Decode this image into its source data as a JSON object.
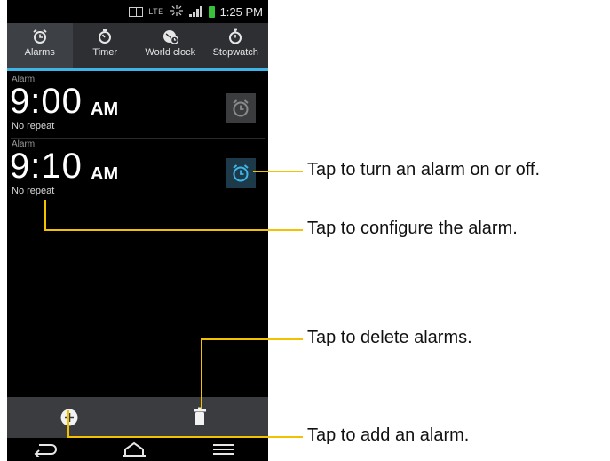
{
  "status_bar": {
    "network": "LTE",
    "time": "1:25 PM"
  },
  "tabs": [
    {
      "label": "Alarms",
      "icon": "alarm-clock-icon",
      "active": true
    },
    {
      "label": "Timer",
      "icon": "timer-icon",
      "active": false
    },
    {
      "label": "World clock",
      "icon": "globe-clock-icon",
      "active": false
    },
    {
      "label": "Stopwatch",
      "icon": "stopwatch-icon",
      "active": false
    }
  ],
  "alarms": [
    {
      "caption": "Alarm",
      "time": "9:00",
      "ampm": "AM",
      "repeat": "No repeat",
      "enabled": false
    },
    {
      "caption": "Alarm",
      "time": "9:10",
      "ampm": "AM",
      "repeat": "No repeat",
      "enabled": true
    }
  ],
  "colors": {
    "accent": "#3fb4e6",
    "callout": "#f2c200",
    "enabled_icon": "#3fb4e6",
    "disabled_icon": "#8a8a8a"
  },
  "bottom_bar": {
    "add_icon": "plus-circle-icon",
    "delete_icon": "trash-icon"
  },
  "nav_bar": {
    "back_icon": "back-icon",
    "home_icon": "home-icon",
    "menu_icon": "menu-icon"
  },
  "annotations": [
    "Tap to turn an alarm on or off.",
    "Tap to configure the alarm.",
    "Tap to delete alarms.",
    "Tap to add an alarm."
  ]
}
